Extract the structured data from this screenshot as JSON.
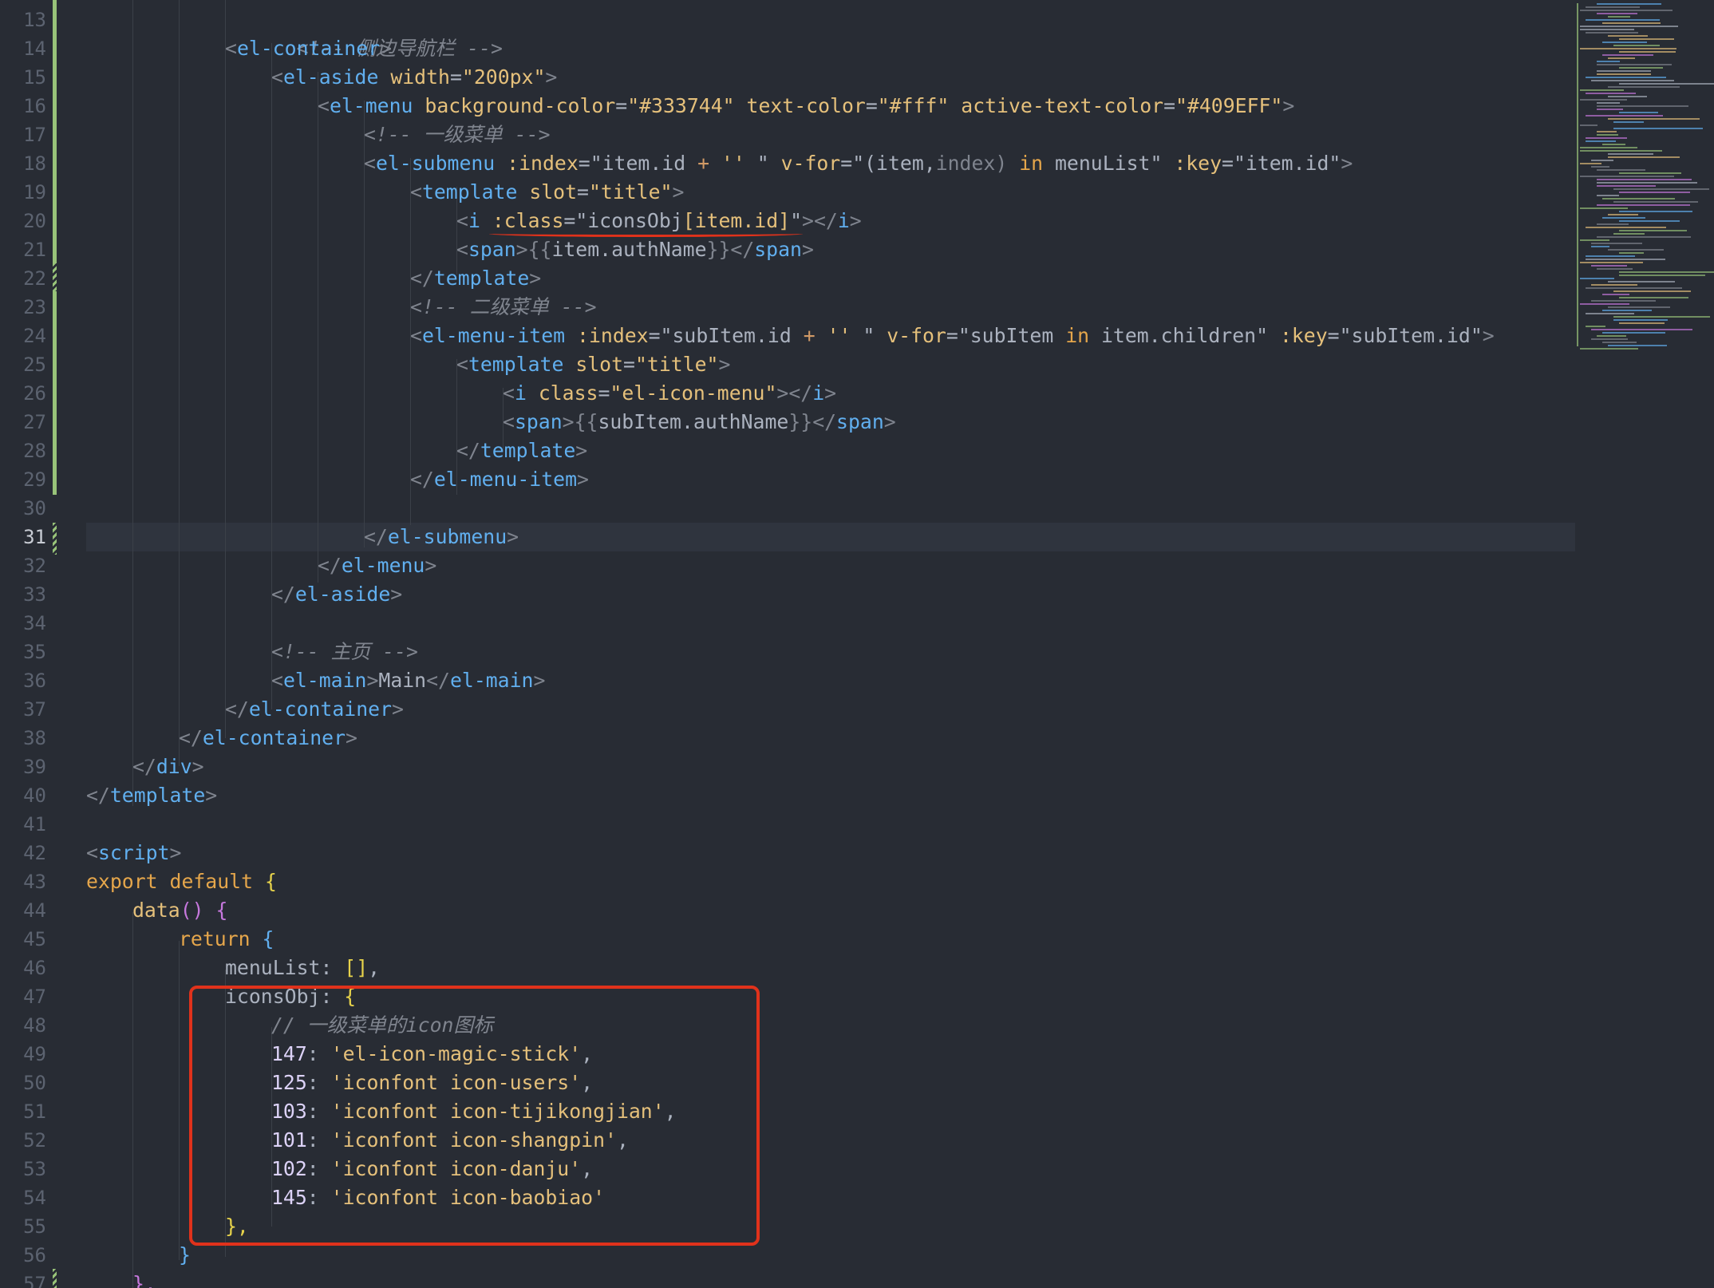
{
  "editor": {
    "current_line": 31,
    "gutter_numbers": [
      "13",
      "14",
      "15",
      "16",
      "17",
      "18",
      "19",
      "20",
      "21",
      "22",
      "23",
      "24",
      "25",
      "26",
      "27",
      "28",
      "29",
      "30",
      "31",
      "32",
      "33",
      "34",
      "35",
      "36",
      "37",
      "38",
      "39",
      "40",
      "41",
      "42",
      "43",
      "44",
      "45",
      "46",
      "47",
      "48",
      "49",
      "50",
      "51",
      "52",
      "53",
      "54",
      "55",
      "56",
      "57"
    ],
    "code": {
      "l13_comment": "<!-- 侧边导航栏 -->",
      "l14_tag": "el-container",
      "l15_tag": "el-aside",
      "l15_attr": "width",
      "l15_val": "\"200px\"",
      "l16_tag": "el-menu",
      "l16_attr1": "background-color",
      "l16_val1": "\"#333744\"",
      "l16_attr2": "text-color",
      "l16_val2": "\"#fff\"",
      "l16_attr3": "active-text-color",
      "l16_val3": "\"#409EFF\"",
      "l17_comment": "<!-- 一级菜单 -->",
      "l18_tag": "el-submenu",
      "l18_attr1": ":index",
      "l18_val1a": "\"item.id ",
      "l18_op1": "+",
      "l18_val1b": " ''",
      "l18_val1c": " \"",
      "l18_attr2": "v-for",
      "l18_val2a": "\"(item,",
      "l18_val2b": "index)",
      "l18_kw_in": "in",
      "l18_val2c": " menuList\"",
      "l18_attr3": ":key",
      "l18_val3": "\"item.id\"",
      "l19_tag": "template",
      "l19_attr": "slot",
      "l19_val": "\"title\"",
      "l20_tag": "i",
      "l20_attr": ":class",
      "l20_val_a": "\"iconsObj",
      "l20_val_b": "[item.id]",
      "l20_val_c": "\"",
      "l20_close_tag": "i",
      "l21_tag": "span",
      "l21_mustache_open": "{{",
      "l21_expr": "item.authName",
      "l21_mustache_close": "}}",
      "l21_close_tag": "span",
      "l22_close_tag": "template",
      "l23_comment": "<!-- 二级菜单 -->",
      "l24_tag": "el-menu-item",
      "l24_attr1": ":index",
      "l24_val1a": "\"subItem.id ",
      "l24_op1": "+",
      "l24_val1b": " ''",
      "l24_val1c": " \"",
      "l24_attr2": "v-for",
      "l24_val2a": "\"subItem ",
      "l24_kw_in": "in",
      "l24_val2b": " item.children\"",
      "l24_attr3": ":key",
      "l24_val3": "\"subItem.id\"",
      "l25_tag": "template",
      "l25_attr": "slot",
      "l25_val": "\"title\"",
      "l26_tag": "i",
      "l26_attr": "class",
      "l26_val": "\"el-icon-menu\"",
      "l26_close_tag": "i",
      "l27_tag": "span",
      "l27_mustache_open": "{{",
      "l27_expr": "subItem.authName",
      "l27_mustache_close": "}}",
      "l27_close_tag": "span",
      "l28_close_tag": "template",
      "l29_close_tag": "el-menu-item",
      "l31_close_tag": "el-submenu",
      "l32_close_tag": "el-menu",
      "l33_close_tag": "el-aside",
      "l35_comment": "<!-- 主页 -->",
      "l36_tag": "el-main",
      "l36_text": "Main",
      "l36_close_tag": "el-main",
      "l37_close_tag": "el-container",
      "l38_close_tag": "el-container",
      "l39_close_tag": "div",
      "l40_close_tag": "template",
      "l42_tag": "script",
      "l43_kw1": "export",
      "l43_kw2": "default",
      "l43_brace": "{",
      "l44_fn": "data",
      "l44_parens": "()",
      "l44_brace": "{",
      "l45_kw": "return",
      "l45_brace": "{",
      "l46_key": "menuList",
      "l46_val": "[]",
      "l46_comma": ",",
      "l47_key": "iconsObj",
      "l47_brace": "{",
      "l48_comment": "// 一级菜单的icon图标",
      "icons": [
        {
          "key": "147",
          "value": "'el-icon-magic-stick'",
          "comma": ","
        },
        {
          "key": "125",
          "value": "'iconfont icon-users'",
          "comma": ","
        },
        {
          "key": "103",
          "value": "'iconfont icon-tijikongjian'",
          "comma": ","
        },
        {
          "key": "101",
          "value": "'iconfont icon-shangpin'",
          "comma": ","
        },
        {
          "key": "102",
          "value": "'iconfont icon-danju'",
          "comma": ","
        },
        {
          "key": "145",
          "value": "'iconfont icon-baobiao'",
          "comma": ""
        }
      ],
      "l55_close": "},",
      "l56_close": "}",
      "l57_close": "},"
    }
  },
  "colors": {
    "background": "#282c34",
    "annotation_red": "#e0321b",
    "git_added": "#98c379"
  }
}
